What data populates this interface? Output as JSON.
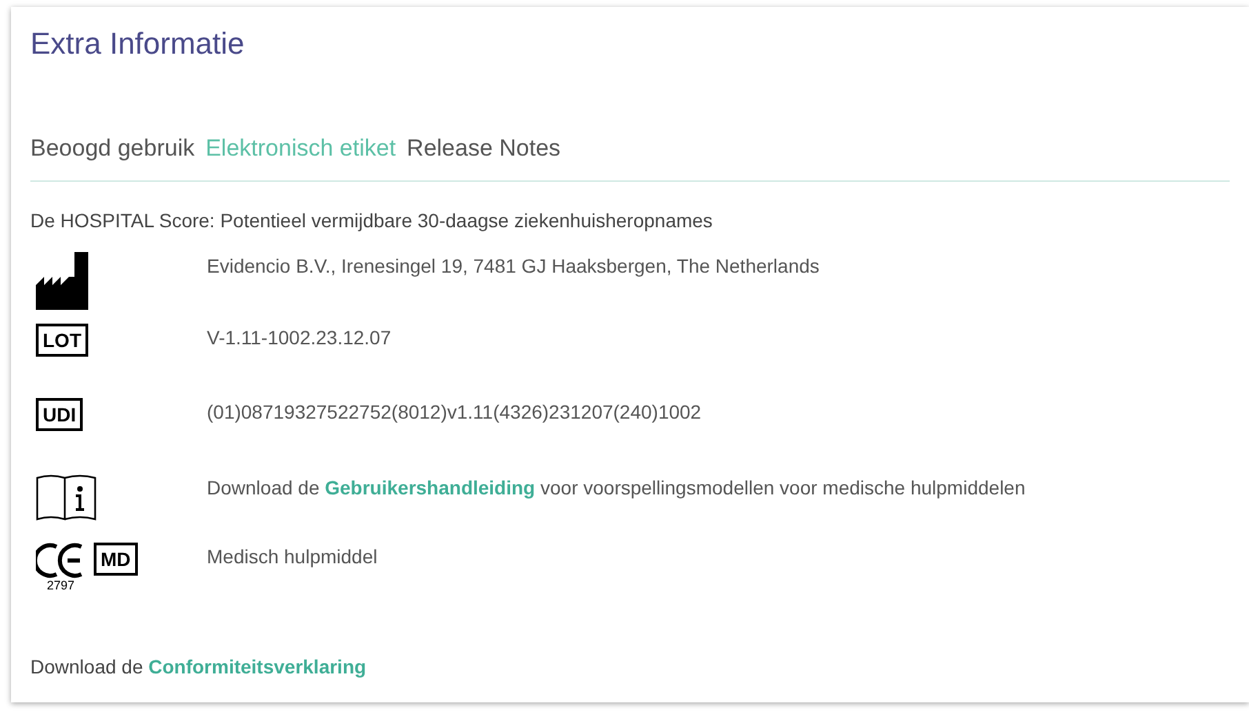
{
  "title": "Extra Informatie",
  "tabs": [
    {
      "label": "Beoogd gebruik",
      "selected": false
    },
    {
      "label": "Elektronisch etiket",
      "selected": true
    },
    {
      "label": "Release Notes",
      "selected": false
    }
  ],
  "model_name": "De HOSPITAL Score: Potentieel vermijdbare 30-daagse ziekenhuisheropnames",
  "rows": [
    {
      "kind": "manufacturer",
      "text": "Evidencio B.V., Irenesingel 19, 7481 GJ Haaksbergen, The Netherlands"
    },
    {
      "kind": "lot",
      "symbol": "LOT",
      "text": "V-1.11-1002.23.12.07"
    },
    {
      "kind": "udi",
      "symbol": "UDI",
      "text": "(01)08719327522752(8012)v1.11(4326)231207(240)1002"
    },
    {
      "kind": "manual",
      "prefix": "Download de",
      "link": "Gebruikershandleiding",
      "suffix": "voor voorspellingsmodellen voor medische hulpmiddelen"
    },
    {
      "kind": "ce",
      "symbol": "MD",
      "notified_body": "2797",
      "text": "Medisch hulpmiddel"
    }
  ],
  "footer": {
    "prefix": "Download de",
    "link": "Conformiteitsverklaring"
  }
}
